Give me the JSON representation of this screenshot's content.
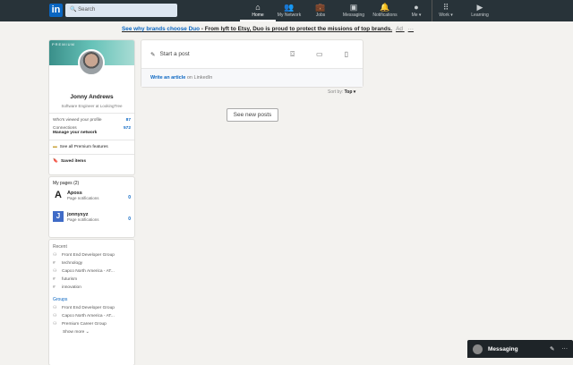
{
  "nav": {
    "logo": "in",
    "search_placeholder": "Search",
    "items": [
      {
        "label": "Home",
        "icon": "⌂"
      },
      {
        "label": "My Network",
        "icon": "👥"
      },
      {
        "label": "Jobs",
        "icon": "💼"
      },
      {
        "label": "Messaging",
        "icon": "▣"
      },
      {
        "label": "Notifications",
        "icon": "🔔"
      },
      {
        "label": "Me ▾",
        "icon": "●"
      },
      {
        "label": "Work ▾",
        "icon": "⠿"
      },
      {
        "label": "Learning",
        "icon": "▶"
      }
    ]
  },
  "ad": {
    "link": "See why brands choose Duo",
    "text": " - From lyft to Etsy, Duo is proud to protect the missions of top brands.",
    "tag": "Ad",
    "more": "···"
  },
  "profile": {
    "banner": "PREMIUM",
    "name": "Jonny Andrews",
    "headline": "Software Engineer at LookingTree",
    "viewed_label": "Who's viewed your profile",
    "viewed": "87",
    "connections_label": "Connections",
    "connections": "572",
    "manage": "Manage your network",
    "premium": "See all Premium features",
    "saved": "Saved items"
  },
  "pages": {
    "title": "My pages (2)",
    "items": [
      {
        "name": "Aposs",
        "sub": "Page notifications",
        "count": "0",
        "icon": "A"
      },
      {
        "name": "jonnyxyz",
        "sub": "Page notifications",
        "count": "0",
        "icon": "J"
      }
    ]
  },
  "recent": {
    "title": "Recent",
    "items": [
      {
        "icon": "group",
        "label": "Front End Developer Group"
      },
      {
        "icon": "hashtag",
        "label": "technology"
      },
      {
        "icon": "group",
        "label": "Capco North America - AT..."
      },
      {
        "icon": "hashtag",
        "label": "futurism"
      },
      {
        "icon": "hashtag",
        "label": "innovation"
      }
    ],
    "groups_title": "Groups",
    "groups": [
      {
        "label": "Front End Developer Group"
      },
      {
        "label": "Capco North America - AT..."
      },
      {
        "label": "Premium Career Group"
      }
    ],
    "show_more": "Show more ⌄"
  },
  "share": {
    "start": "Start a post",
    "write": "Write an article",
    "on": " on LinkedIn"
  },
  "sort": {
    "label": "Sort by: ",
    "value": "Top ▾"
  },
  "new_posts": "See new posts",
  "messaging": {
    "label": "Messaging",
    "compose": "✎",
    "more": "···"
  }
}
